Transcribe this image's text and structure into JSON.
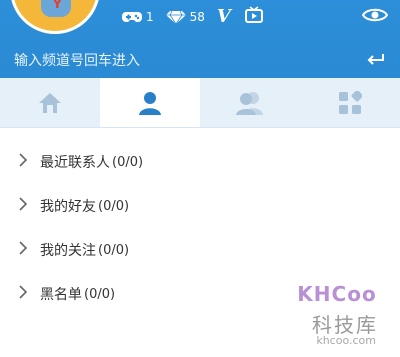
{
  "header": {
    "stats": [
      {
        "icon": "gamepad-icon",
        "value": "1"
      },
      {
        "icon": "diamond-icon",
        "value": "58"
      }
    ],
    "v_badge": "V",
    "search": {
      "placeholder": "输入频道号回车进入"
    }
  },
  "tabs": [
    {
      "icon": "home-icon",
      "active": false
    },
    {
      "icon": "person-icon",
      "active": true
    },
    {
      "icon": "contacts-icon",
      "active": false
    },
    {
      "icon": "apps-icon",
      "active": false
    }
  ],
  "list": [
    {
      "label": "最近联系人",
      "count": "(0/0)"
    },
    {
      "label": "我的好友",
      "count": "(0/0)"
    },
    {
      "label": "我的关注",
      "count": "(0/0)"
    },
    {
      "label": "黑名单",
      "count": "(0/0)"
    }
  ],
  "watermark": {
    "logo": "KHCoo",
    "cn": "科技库",
    "url": "khcoo.com"
  },
  "colors": {
    "header_blue": "#2a8ad3",
    "tab_bg": "#e6f0f8",
    "active_icon": "#2a7fc9",
    "inactive_icon": "#a8c3d9"
  }
}
